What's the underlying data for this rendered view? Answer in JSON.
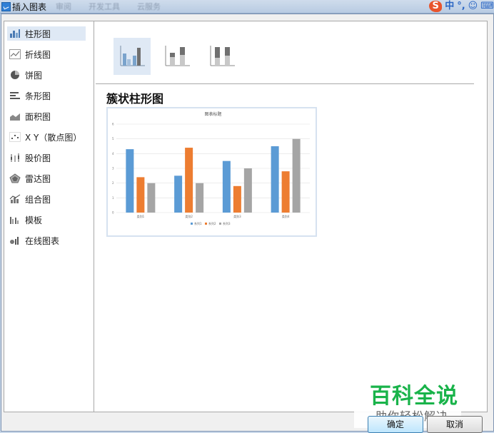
{
  "window": {
    "title": "插入图表",
    "ghost_tabs": [
      "审阅",
      "开发工具",
      "云服务"
    ]
  },
  "sidebar": {
    "items": [
      {
        "label": "柱形图",
        "icon": "column-chart-icon",
        "active": true
      },
      {
        "label": "折线图",
        "icon": "line-chart-icon"
      },
      {
        "label": "饼图",
        "icon": "pie-chart-icon"
      },
      {
        "label": "条形图",
        "icon": "bar-chart-icon"
      },
      {
        "label": "面积图",
        "icon": "area-chart-icon"
      },
      {
        "label": "X Y（散点图）",
        "icon": "scatter-chart-icon"
      },
      {
        "label": "股价图",
        "icon": "stock-chart-icon"
      },
      {
        "label": "雷达图",
        "icon": "radar-chart-icon"
      },
      {
        "label": "组合图",
        "icon": "combo-chart-icon"
      },
      {
        "label": "模板",
        "icon": "template-icon"
      },
      {
        "label": "在线图表",
        "icon": "online-chart-icon"
      }
    ]
  },
  "subtypes": [
    {
      "icon": "clustered-column-icon",
      "active": true
    },
    {
      "icon": "stacked-column-icon"
    },
    {
      "icon": "percent-stacked-column-icon"
    }
  ],
  "selected_subtype_title": "簇状柱形图",
  "chart_data": {
    "type": "bar",
    "title": "图表标题",
    "categories": [
      "类别1",
      "类别2",
      "类别3",
      "类别4"
    ],
    "series": [
      {
        "name": "系列1",
        "values": [
          4.3,
          2.5,
          3.5,
          4.5
        ],
        "color": "#5b9bd5"
      },
      {
        "name": "系列2",
        "values": [
          2.4,
          4.4,
          1.8,
          2.8
        ],
        "color": "#ed7d31"
      },
      {
        "name": "系列3",
        "values": [
          2,
          2,
          3,
          5
        ],
        "color": "#a5a5a5"
      }
    ],
    "ylim": [
      0,
      6
    ],
    "yticks": [
      "0",
      "1",
      "2",
      "3",
      "4",
      "5",
      "6"
    ],
    "grid": true,
    "legend": "bottom"
  },
  "watermark": {
    "title": "百科全说",
    "subtitle": "助你轻松解决"
  },
  "buttons": {
    "ok": "确定",
    "cancel": "取消"
  },
  "ime": {
    "labels": [
      "中",
      "°,",
      "☺",
      "⌨"
    ]
  },
  "colors": {
    "accent": "#5b9bd5",
    "selection": "#dfe9f5",
    "watermark": "#19b34a"
  }
}
